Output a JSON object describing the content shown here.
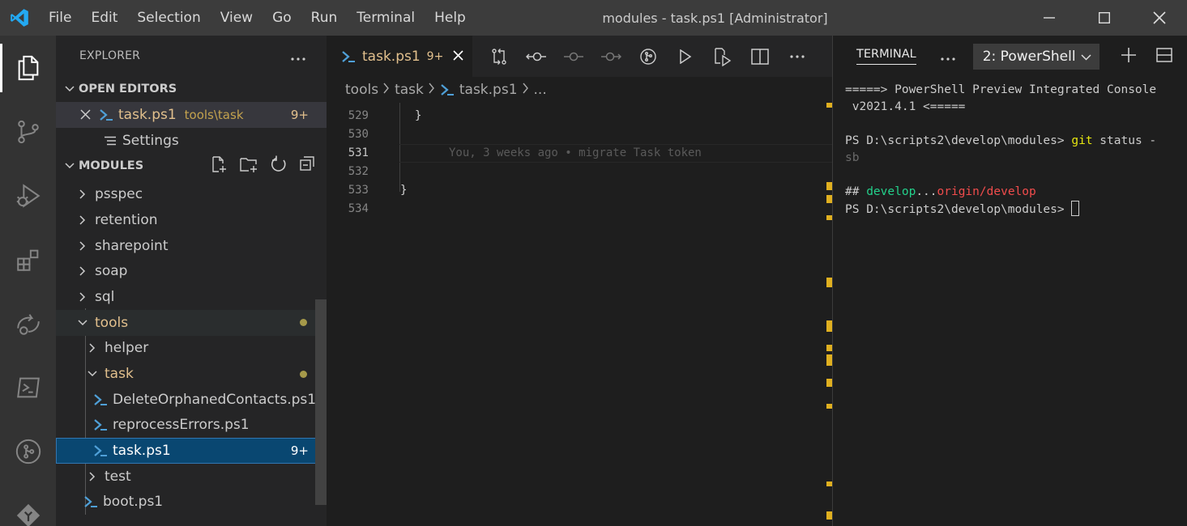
{
  "titlebar": {
    "menu": [
      "File",
      "Edit",
      "Selection",
      "View",
      "Go",
      "Run",
      "Terminal",
      "Help"
    ],
    "title": "modules - task.ps1 [Administrator]"
  },
  "activity_bar": [
    "explorer-icon",
    "source-control-icon",
    "run-debug-icon",
    "extensions-icon",
    "remote-explorer-icon",
    "powershell-icon",
    "git-graph-icon",
    "gitlens-icon"
  ],
  "sidebar": {
    "title": "EXPLORER",
    "open_editors": {
      "label": "OPEN EDITORS",
      "items": [
        {
          "name": "task.ps1",
          "path": "tools\\task",
          "badge": "9+"
        },
        {
          "name": "Settings"
        }
      ]
    },
    "modules": {
      "label": "MODULES",
      "items": [
        {
          "label": "psspec"
        },
        {
          "label": "retention"
        },
        {
          "label": "sharepoint"
        },
        {
          "label": "soap"
        },
        {
          "label": "sql"
        },
        {
          "label": "tools"
        },
        {
          "label": "helper"
        },
        {
          "label": "task"
        },
        {
          "label": "DeleteOrphanedContacts.ps1"
        },
        {
          "label": "reprocessErrors.ps1"
        },
        {
          "label": "task.ps1",
          "badge": "9+"
        },
        {
          "label": "test"
        },
        {
          "label": "boot.ps1"
        }
      ]
    }
  },
  "editor": {
    "tab": {
      "label": "task.ps1",
      "badge": "9+"
    },
    "breadcrumb": [
      "tools",
      "task",
      "task.ps1",
      "..."
    ],
    "lines": [
      {
        "num": "529",
        "text": "}"
      },
      {
        "num": "530",
        "text": ""
      },
      {
        "num": "531",
        "text": "",
        "blame": "You, 3 weeks ago • migrate Task token"
      },
      {
        "num": "532",
        "text": ""
      },
      {
        "num": "533",
        "text": "}"
      },
      {
        "num": "534",
        "text": ""
      }
    ]
  },
  "terminal": {
    "tab": "TERMINAL",
    "shell": "2: PowerShell",
    "lines": {
      "banner1": "=====> PowerShell Preview Integrated Console",
      "banner2": " v2021.4.1 <=====",
      "prompt": "PS D:\\scripts2\\develop\\modules> ",
      "cmd": "git",
      "args": " status -",
      "args2": "sb",
      "hash": "## ",
      "branch": "develop",
      "dots": "...",
      "remote": "origin/develop"
    }
  },
  "colors": {
    "accent": "#e2c08d",
    "selection": "#094771",
    "powershell": "#4fa0d8"
  }
}
